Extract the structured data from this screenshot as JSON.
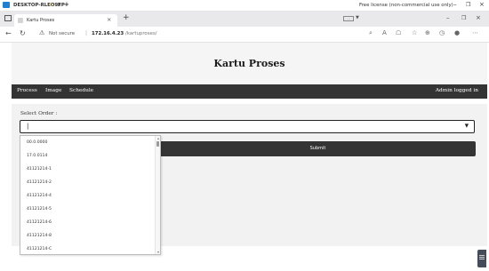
{
  "remote_bar": {
    "machine_name": "DESKTOP-RLEO9FP",
    "license_text": "Free license (non-commercial use only)"
  },
  "browser": {
    "tab_title": "Kartu Proses",
    "tab_close": "×",
    "new_tab": "+",
    "security_label": "Not secure",
    "url_host": "172.16.4.23",
    "url_path": "/kartuproses/"
  },
  "page": {
    "site_title": "Kartu Proses",
    "nav": {
      "links": [
        "Process",
        "Image",
        "Schedule"
      ],
      "admin": "Admin logged in"
    },
    "form": {
      "label": "Select Order :",
      "input_value": "|",
      "submit_label": "Submit"
    },
    "dropdown_options": [
      "00.0.0000",
      "17.0.0114",
      "41121214-1",
      "41121214-2",
      "41121214-4",
      "41121214-5",
      "41121214-6",
      "41121214-8",
      "41121214-C"
    ]
  },
  "colors": {
    "navbar": "#343434",
    "header_bg": "#f5f5f5",
    "panel_bg": "#f2f2f2"
  }
}
